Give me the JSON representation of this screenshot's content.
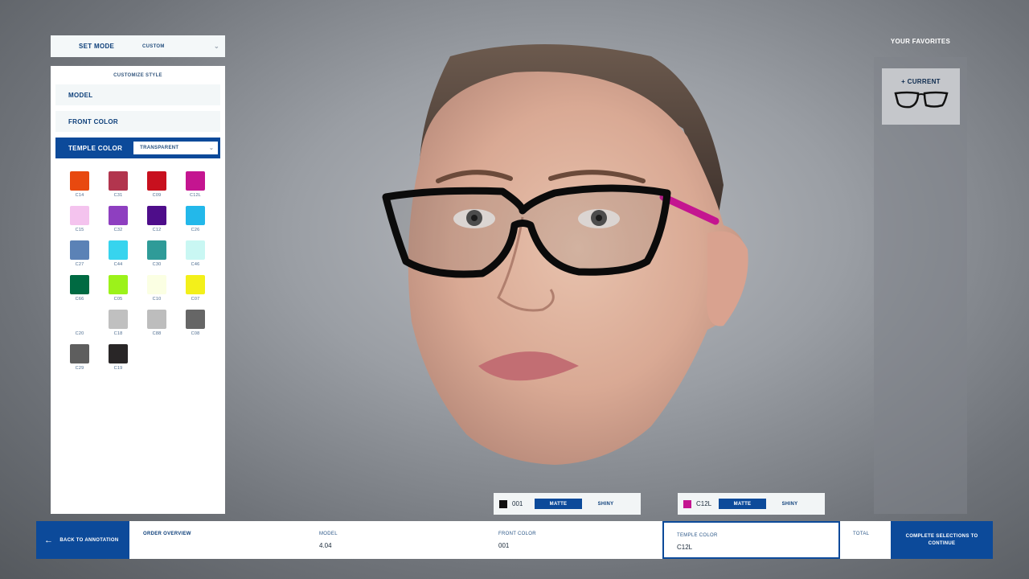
{
  "mode": {
    "label": "SET MODE",
    "value": "CUSTOM"
  },
  "customize": {
    "heading": "CUSTOMIZE STYLE",
    "model_label": "MODEL",
    "front_color_label": "FRONT COLOR",
    "temple_color_label": "TEMPLE COLOR",
    "temple_select_value": "TRANSPARENT"
  },
  "swatches": [
    {
      "code": "C14",
      "color": "#e8490f"
    },
    {
      "code": "C31",
      "color": "#b2354e"
    },
    {
      "code": "C09",
      "color": "#c8101e"
    },
    {
      "code": "C12L",
      "color": "#c41590"
    },
    {
      "code": "C15",
      "color": "#f4c3ee"
    },
    {
      "code": "C32",
      "color": "#8e3fc0"
    },
    {
      "code": "C12",
      "color": "#4e0d8a"
    },
    {
      "code": "C26",
      "color": "#23b8ea"
    },
    {
      "code": "C27",
      "color": "#5b82b6"
    },
    {
      "code": "C44",
      "color": "#37d4ee"
    },
    {
      "code": "C30",
      "color": "#2f9b98"
    },
    {
      "code": "C46",
      "color": "#c9f7f3"
    },
    {
      "code": "C66",
      "color": "#006a42"
    },
    {
      "code": "C05",
      "color": "#9cf21a"
    },
    {
      "code": "C10",
      "color": "#fbffe3"
    },
    {
      "code": "C07",
      "color": "#f3f01a"
    },
    {
      "code": "C20",
      "color": "#ffffff"
    },
    {
      "code": "C18",
      "color": "#c0c0c0"
    },
    {
      "code": "C88",
      "color": "#bdbdbd"
    },
    {
      "code": "C08",
      "color": "#666666"
    },
    {
      "code": "C29",
      "color": "#5e5e5e"
    },
    {
      "code": "C19",
      "color": "#292627"
    }
  ],
  "favorites": {
    "title": "YOUR FAVORITES",
    "current_label": "+ CURRENT"
  },
  "front_finish": {
    "code": "001",
    "swatch_color": "#111111",
    "matte": "MATTE",
    "shiny": "SHINY"
  },
  "temple_finish": {
    "code": "C12L",
    "swatch_color": "#c41590",
    "matte": "MATTE",
    "shiny": "SHINY"
  },
  "bottom": {
    "back_label": "BACK TO ANNOTATION",
    "order_overview": "ORDER OVERVIEW",
    "model_key": "MODEL",
    "model_value": "4.04",
    "front_key": "FRONT COLOR",
    "front_value": "001",
    "temple_key": "TEMPLE COLOR",
    "temple_value": "C12L",
    "total_key": "TOTAL",
    "complete_label": "COMPLETE SELECTIONS TO CONTINUE"
  },
  "colors": {
    "accent": "#0c4a9a",
    "temple": "#c41590"
  }
}
